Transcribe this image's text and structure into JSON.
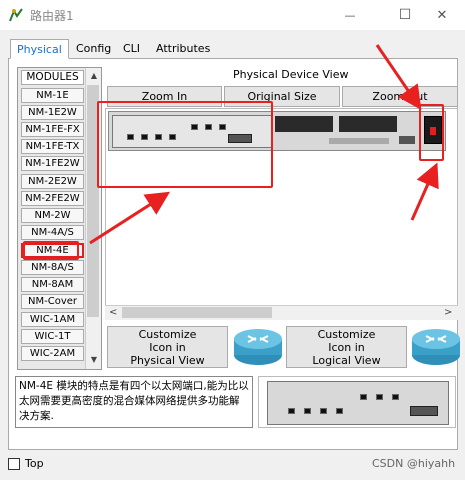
{
  "window": {
    "title": "路由器1",
    "minimize_glyph": "—",
    "maximize_glyph": "☐",
    "close_glyph": "✕"
  },
  "tabs": [
    {
      "label": "Physical",
      "active": true
    },
    {
      "label": "Config",
      "active": false
    },
    {
      "label": "CLI",
      "active": false
    },
    {
      "label": "Attributes",
      "active": false
    }
  ],
  "modules": {
    "header": "MODULES",
    "items": [
      "NM-1E",
      "NM-1E2W",
      "NM-1FE-FX",
      "NM-1FE-TX",
      "NM-1FE2W",
      "NM-2E2W",
      "NM-2FE2W",
      "NM-2W",
      "NM-4A/S",
      "NM-4E",
      "NM-8A/S",
      "NM-8AM",
      "NM-Cover",
      "WIC-1AM",
      "WIC-1T",
      "WIC-2AM"
    ],
    "selected": "NM-4E"
  },
  "physical_view": {
    "label": "Physical Device View",
    "zoom_in": "Zoom In",
    "original_size": "Original Size",
    "zoom_out": "Zoom Out"
  },
  "customize": {
    "physical": {
      "line1": "Customize",
      "line2": "Icon in",
      "line3": "Physical View"
    },
    "logical": {
      "line1": "Customize",
      "line2": "Icon in",
      "line3": "Logical View"
    }
  },
  "description": "NM-4E 模块的特点是有四个以太网端口,能为比以太网需要更高密度的混合媒体网络提供多功能解决方案.",
  "bottom": {
    "top_label": "Top",
    "watermark": "CSDN @hiyahh"
  },
  "colors": {
    "accent": "#1a6fcc",
    "annotation": "#e82020",
    "router_icon": "#3aa0c8"
  }
}
